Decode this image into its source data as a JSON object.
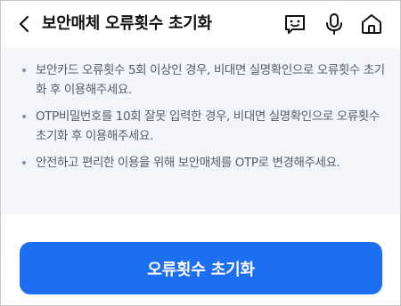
{
  "header": {
    "title": "보안매체 오류횟수 초기화",
    "icons": {
      "back": "back-arrow-icon",
      "chatbot": "chatbot-icon",
      "mic": "microphone-icon",
      "home": "home-icon"
    }
  },
  "notice": {
    "items": [
      "보안카드 오류횟수 5회 이상인 경우, 비대면 실명확인으로 오류횟수 초기화 후 이용해주세요.",
      "OTP비밀번호를 10회 잘못 입력한 경우, 비대면 실명확인으로 오류횟수 초기화 후 이용해주세요.",
      "안전하고 편리한 이용을 위해 보안매체를 OTP로 변경해주세요."
    ]
  },
  "actions": {
    "primary_label": "오류횟수 초기화"
  },
  "colors": {
    "accent": "#1d6ff2",
    "notice_bg": "#f3f5fa",
    "notice_text": "#555d6b"
  }
}
